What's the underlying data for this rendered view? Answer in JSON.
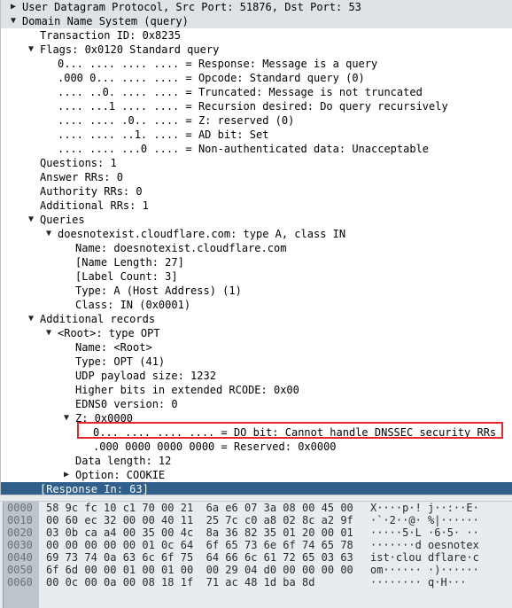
{
  "tree": [
    {
      "depth": 0,
      "twisty": "▶",
      "text": "User Datagram Protocol, Src Port: 51876, Dst Port: 53",
      "style": "header"
    },
    {
      "depth": 0,
      "twisty": "▼",
      "text": "Domain Name System (query)",
      "style": "header"
    },
    {
      "depth": 2,
      "twisty": "",
      "text": "Transaction ID: 0x8235"
    },
    {
      "depth": 2,
      "twisty": "▼",
      "text": "Flags: 0x0120 Standard query"
    },
    {
      "depth": 3,
      "twisty": "",
      "text": "0... .... .... .... = Response: Message is a query"
    },
    {
      "depth": 3,
      "twisty": "",
      "text": ".000 0... .... .... = Opcode: Standard query (0)"
    },
    {
      "depth": 3,
      "twisty": "",
      "text": ".... ..0. .... .... = Truncated: Message is not truncated"
    },
    {
      "depth": 3,
      "twisty": "",
      "text": ".... ...1 .... .... = Recursion desired: Do query recursively"
    },
    {
      "depth": 3,
      "twisty": "",
      "text": ".... .... .0.. .... = Z: reserved (0)"
    },
    {
      "depth": 3,
      "twisty": "",
      "text": ".... .... ..1. .... = AD bit: Set"
    },
    {
      "depth": 3,
      "twisty": "",
      "text": ".... .... ...0 .... = Non-authenticated data: Unacceptable"
    },
    {
      "depth": 2,
      "twisty": "",
      "text": "Questions: 1"
    },
    {
      "depth": 2,
      "twisty": "",
      "text": "Answer RRs: 0"
    },
    {
      "depth": 2,
      "twisty": "",
      "text": "Authority RRs: 0"
    },
    {
      "depth": 2,
      "twisty": "",
      "text": "Additional RRs: 1"
    },
    {
      "depth": 2,
      "twisty": "▼",
      "text": "Queries"
    },
    {
      "depth": 3,
      "twisty": "▼",
      "text": "doesnotexist.cloudflare.com: type A, class IN"
    },
    {
      "depth": 4,
      "twisty": "",
      "text": "Name: doesnotexist.cloudflare.com"
    },
    {
      "depth": 4,
      "twisty": "",
      "text": "[Name Length: 27]"
    },
    {
      "depth": 4,
      "twisty": "",
      "text": "[Label Count: 3]"
    },
    {
      "depth": 4,
      "twisty": "",
      "text": "Type: A (Host Address) (1)"
    },
    {
      "depth": 4,
      "twisty": "",
      "text": "Class: IN (0x0001)"
    },
    {
      "depth": 2,
      "twisty": "▼",
      "text": "Additional records"
    },
    {
      "depth": 3,
      "twisty": "▼",
      "text": "<Root>: type OPT"
    },
    {
      "depth": 4,
      "twisty": "",
      "text": "Name: <Root>"
    },
    {
      "depth": 4,
      "twisty": "",
      "text": "Type: OPT (41)"
    },
    {
      "depth": 4,
      "twisty": "",
      "text": "UDP payload size: 1232"
    },
    {
      "depth": 4,
      "twisty": "",
      "text": "Higher bits in extended RCODE: 0x00"
    },
    {
      "depth": 4,
      "twisty": "",
      "text": "EDNS0 version: 0"
    },
    {
      "depth": 4,
      "twisty": "▼",
      "text": "Z: 0x0000"
    },
    {
      "depth": 5,
      "twisty": "",
      "text": "0... .... .... .... = DO bit: Cannot handle DNSSEC security RRs",
      "highlight": true
    },
    {
      "depth": 5,
      "twisty": "",
      "text": ".000 0000 0000 0000 = Reserved: 0x0000"
    },
    {
      "depth": 4,
      "twisty": "",
      "text": "Data length: 12"
    },
    {
      "depth": 4,
      "twisty": "▶",
      "text": "Option: COOKIE"
    },
    {
      "depth": 2,
      "twisty": "",
      "text": "[Response In: 63]",
      "style": "selected"
    }
  ],
  "hex_dump": [
    {
      "offset": "0000",
      "bytes": "58 9c fc 10 c1 70 00 21  6a e6 07 3a 08 00 45 00",
      "ascii": "X····p·! j··:··E·"
    },
    {
      "offset": "0010",
      "bytes": "00 60 ec 32 00 00 40 11  25 7c c0 a8 02 8c a2 9f",
      "ascii": "·`·2··@· %|······"
    },
    {
      "offset": "0020",
      "bytes": "03 0b ca a4 00 35 00 4c  8a 36 82 35 01 20 00 01",
      "ascii": "·····5·L ·6·5· ··"
    },
    {
      "offset": "0030",
      "bytes": "00 00 00 00 00 01 0c 64  6f 65 73 6e 6f 74 65 78",
      "ascii": "·······d oesnotex"
    },
    {
      "offset": "0040",
      "bytes": "69 73 74 0a 63 6c 6f 75  64 66 6c 61 72 65 03 63",
      "ascii": "ist·clou dflare·c"
    },
    {
      "offset": "0050",
      "bytes": "6f 6d 00 00 01 00 01 00  00 29 04 d0 00 00 00 00",
      "ascii": "om······ ·)······"
    },
    {
      "offset": "0060",
      "bytes": "00 0c 00 0a 00 08 18 1f  71 ac 48 1d ba 8d",
      "ascii": "········ q·H···"
    }
  ],
  "colors": {
    "selection": "#2f5f8a",
    "highlight_box": "#e8292b",
    "header_row": "#dfe3e8"
  }
}
